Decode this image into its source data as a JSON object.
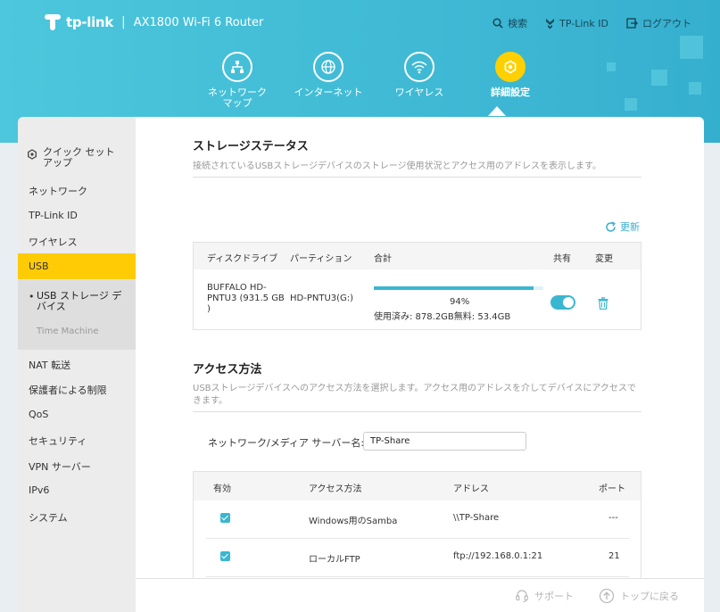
{
  "header": {
    "brand": "tp-link",
    "separator": "|",
    "model": "AX1800 Wi-Fi 6 Router",
    "links": {
      "search": "検索",
      "tplink_id": "TP-Link ID",
      "logout": "ログアウト"
    }
  },
  "nav": {
    "network_map": "ネットワーク マップ",
    "internet": "インターネット",
    "wireless": "ワイヤレス",
    "advanced": "詳細設定"
  },
  "sidebar": {
    "quick_setup": "クイック セット アップ",
    "network": "ネットワーク",
    "tplink_id": "TP-Link ID",
    "wireless": "ワイヤレス",
    "usb": "USB",
    "usb_storage": "USB ストレージ デバイス",
    "time_machine": "Time Machine",
    "nat": "NAT 転送",
    "parental": "保護者による制限",
    "qos": "QoS",
    "security": "セキュリティ",
    "vpn": "VPN サーバー",
    "ipv6": "IPv6",
    "system": "システム"
  },
  "storage": {
    "title": "ストレージステータス",
    "description": "接続されているUSBストレージデバイスのストレージ使用状況とアクセス用のアドレスを表示します。",
    "refresh": "更新",
    "headers": {
      "disk": "ディスクドライブ",
      "partition": "パーティション",
      "total": "合計",
      "share": "共有",
      "change": "変更"
    },
    "row": {
      "disk": "BUFFALO HD-PNTU3 (931.5 GB )",
      "partition": "HD-PNTU3(G:)",
      "percent_label": "94%",
      "usage": "使用済み: 878.2GB無料: 53.4GB",
      "used_fraction": 0.94,
      "shared": true
    }
  },
  "access": {
    "title": "アクセス方法",
    "description": "USBストレージデバイスへのアクセス方法を選択します。アクセス用のアドレスを介してデバイスにアクセスできます。",
    "server_label": "ネットワーク/メディア サーバー名:",
    "server_name": "TP-Share",
    "headers": {
      "enabled": "有効",
      "method": "アクセス方法",
      "address": "アドレス",
      "port": "ポート"
    },
    "rows": [
      {
        "enabled": true,
        "method": "Windows用のSamba",
        "address": "\\\\TP-Share",
        "port": "---"
      },
      {
        "enabled": true,
        "method": "ローカルFTP",
        "address": "ftp://192.168.0.1:21",
        "port": "21"
      }
    ]
  },
  "footer": {
    "support": "サポート",
    "top": "トップに戻る"
  },
  "colors": {
    "accent": "#3ab6d1",
    "highlight": "#ffcb05",
    "header": "#45c0d8"
  }
}
